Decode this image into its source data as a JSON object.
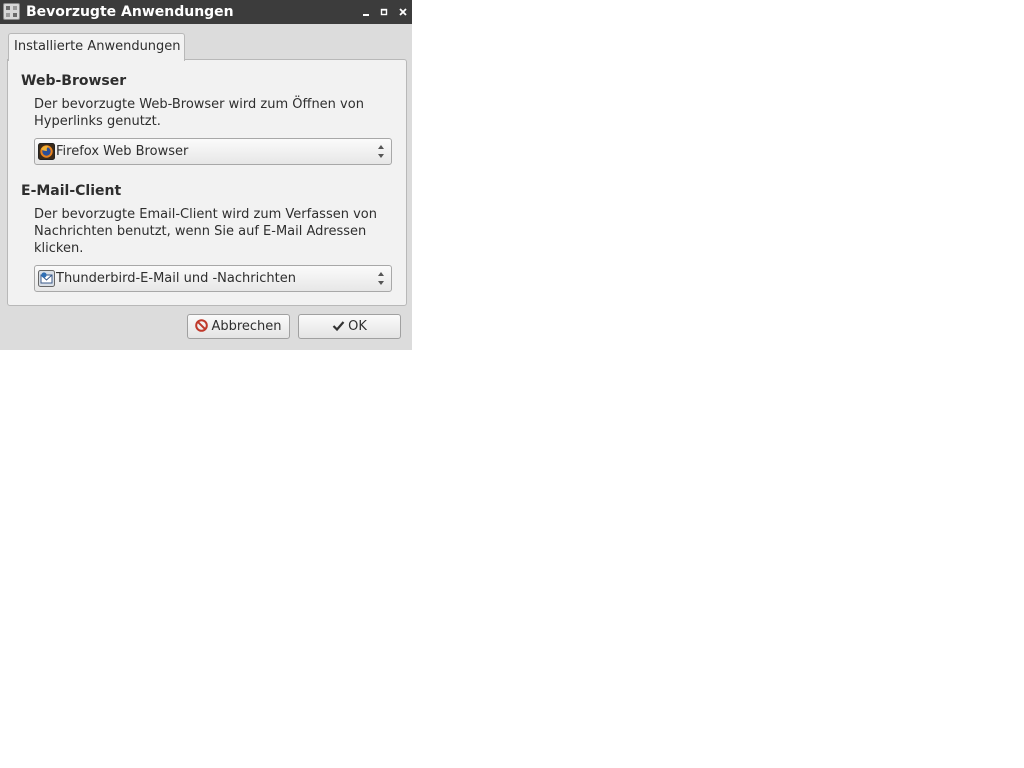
{
  "window": {
    "title": "Bevorzugte Anwendungen",
    "controls": {
      "minimize_icon": "minimize-icon",
      "maximize_icon": "maximize-icon",
      "close_icon": "close-icon"
    }
  },
  "tabs": [
    {
      "label": "Installierte Anwendungen",
      "selected": true
    }
  ],
  "web_browser": {
    "heading": "Web-Browser",
    "description_line1": "Der bevorzugte Web-Browser wird zum Öffnen von",
    "description_line2": "Hyperlinks genutzt.",
    "selected": "Firefox Web Browser",
    "icon": "firefox-icon"
  },
  "mail_client": {
    "heading": "E-Mail-Client",
    "description_line1": "Der bevorzugte Email-Client wird zum Verfassen von",
    "description_line2": "Nachrichten benutzt, wenn Sie auf E-Mail Adressen",
    "description_line3": "klicken.",
    "selected": "Thunderbird-E-Mail und -Nachrichten",
    "icon": "thunderbird-icon"
  },
  "buttons": {
    "cancel_label": "Abbrechen",
    "ok_label": "OK"
  },
  "colors": {
    "titlebar": "#3c3c3c",
    "window_bg": "#dcdcdc",
    "panel_bg": "#f2f2f2",
    "cancel_icon": "#c0392b"
  }
}
